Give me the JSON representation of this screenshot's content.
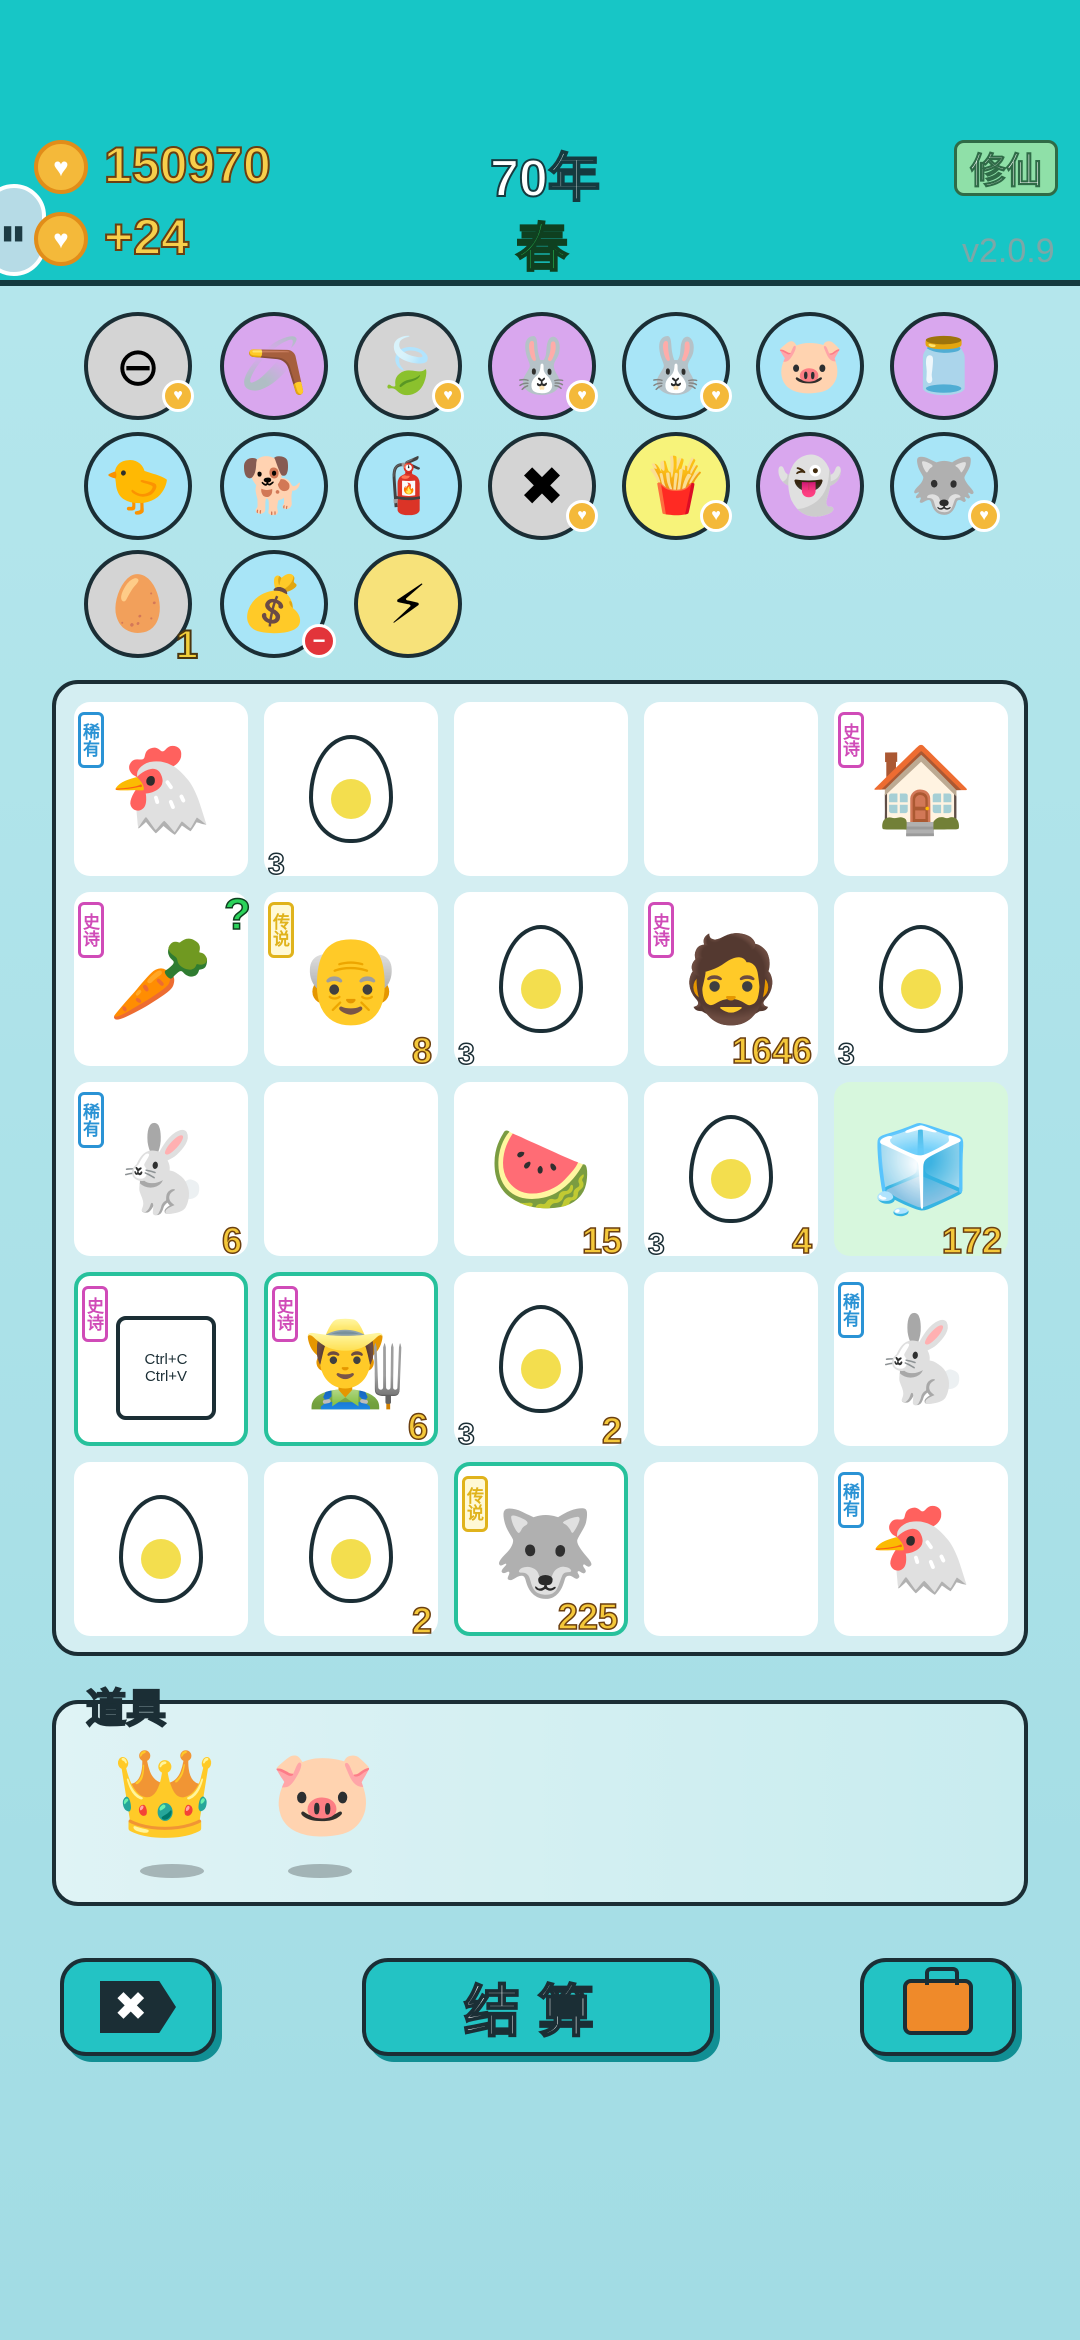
{
  "header": {
    "coins": "150970",
    "income": "+24",
    "year": "70年",
    "season": "春",
    "xiuxian_label": "修仙",
    "version": "v2.0.9"
  },
  "relics": [
    {
      "name": "remove-symbol-icon",
      "emoji": "⊖",
      "bg": "#d4d4d4",
      "badge": "heart"
    },
    {
      "name": "slingshot-icon",
      "emoji": "🪃",
      "bg": "#d9a7ee",
      "badge": ""
    },
    {
      "name": "leaf-icon",
      "emoji": "🍃",
      "bg": "#d4d4d4",
      "badge": "heart"
    },
    {
      "name": "twin-rabbits-icon",
      "emoji": "🐰",
      "bg": "#d9a7ee",
      "badge": "heart"
    },
    {
      "name": "twin-rabbits-icon",
      "emoji": "🐰",
      "bg": "#a8e5f7",
      "badge": "heart"
    },
    {
      "name": "piggy-bank-icon",
      "emoji": "🐷",
      "bg": "#a8e5f7",
      "badge": ""
    },
    {
      "name": "jar-icon",
      "emoji": "🫙",
      "bg": "#d9a7ee",
      "badge": ""
    },
    {
      "name": "chick-with-egg-icon",
      "emoji": "🐤",
      "bg": "#a8e5f7",
      "badge": ""
    },
    {
      "name": "cool-dog-icon",
      "emoji": "🐕",
      "bg": "#a8e5f7",
      "badge": ""
    },
    {
      "name": "pump-icon",
      "emoji": "🧯",
      "bg": "#a8e5f7",
      "badge": ""
    },
    {
      "name": "cancel-tag-icon",
      "emoji": "✖",
      "bg": "#d4d4d4",
      "badge": "heart"
    },
    {
      "name": "fries-icon",
      "emoji": "🍟",
      "bg": "#f7f37a",
      "badge": "heart"
    },
    {
      "name": "ghost-icon",
      "emoji": "👻",
      "bg": "#d9a7ee",
      "badge": ""
    },
    {
      "name": "husky-icon",
      "emoji": "🐺",
      "bg": "#a8e5f7",
      "badge": "heart"
    },
    {
      "name": "egg-tray-icon",
      "emoji": "🥚",
      "bg": "#d4d4d4",
      "badge": "",
      "count": "1"
    },
    {
      "name": "sack-icon",
      "emoji": "💰",
      "bg": "#a8e5f7",
      "badge": "minus"
    },
    {
      "name": "lightning-icon",
      "emoji": "⚡",
      "bg": "#f7e27a",
      "badge": ""
    }
  ],
  "tags": {
    "rare": "稀有",
    "epic": "史诗",
    "legend": "传说"
  },
  "board": [
    [
      {
        "icon": "chicken-icon",
        "emoji": "🐔",
        "tag": "rare",
        "left": "",
        "right": ""
      },
      {
        "icon": "egg-icon",
        "emoji": "egg",
        "tag": "",
        "left": "3",
        "right": ""
      },
      {
        "icon": "",
        "emoji": "",
        "tag": "",
        "left": "",
        "right": ""
      },
      {
        "icon": "",
        "emoji": "",
        "tag": "",
        "left": "",
        "right": ""
      },
      {
        "icon": "rabbit-house-icon",
        "emoji": "🏠",
        "tag": "epic",
        "left": "",
        "right": ""
      }
    ],
    [
      {
        "icon": "carrot-icon",
        "emoji": "🥕",
        "tag": "epic",
        "left": "",
        "right": "",
        "question": "?"
      },
      {
        "icon": "grandpa-icon",
        "emoji": "👴",
        "tag": "legend",
        "left": "",
        "right": "8"
      },
      {
        "icon": "egg-icon",
        "emoji": "egg",
        "tag": "",
        "left": "3",
        "right": ""
      },
      {
        "icon": "bearded-man-icon",
        "emoji": "🧔",
        "tag": "epic",
        "left": "",
        "right": "1646"
      },
      {
        "icon": "egg-icon",
        "emoji": "egg",
        "tag": "",
        "left": "3",
        "right": ""
      }
    ],
    [
      {
        "icon": "rabbit-icon",
        "emoji": "🐇",
        "tag": "rare",
        "left": "",
        "right": "6"
      },
      {
        "icon": "",
        "emoji": "",
        "tag": "",
        "left": "",
        "right": ""
      },
      {
        "icon": "watermelon-icon",
        "emoji": "🍉",
        "tag": "",
        "left": "",
        "right": "15"
      },
      {
        "icon": "egg-icon",
        "emoji": "egg",
        "tag": "",
        "left": "3",
        "right": "4"
      },
      {
        "icon": "fridge-icon",
        "emoji": "🧊",
        "tag": "",
        "left": "",
        "right": "172",
        "fridge": true
      }
    ],
    [
      {
        "icon": "copy-paste-card-icon",
        "emoji": "ctrl",
        "tag": "epic",
        "left": "",
        "right": "",
        "hl": true
      },
      {
        "icon": "farmer-icon",
        "emoji": "👨‍🌾",
        "tag": "epic",
        "left": "",
        "right": "6",
        "hl": true
      },
      {
        "icon": "egg-icon",
        "emoji": "egg",
        "tag": "",
        "left": "3",
        "right": "2"
      },
      {
        "icon": "",
        "emoji": "",
        "tag": "",
        "left": "",
        "right": ""
      },
      {
        "icon": "rabbit-icon",
        "emoji": "🐇",
        "tag": "rare",
        "left": "",
        "right": ""
      }
    ],
    [
      {
        "icon": "egg-icon",
        "emoji": "egg",
        "tag": "",
        "left": "",
        "right": ""
      },
      {
        "icon": "egg-icon",
        "emoji": "egg",
        "tag": "",
        "left": "",
        "right": "2"
      },
      {
        "icon": "husky-king-icon",
        "emoji": "🐺",
        "tag": "legend",
        "left": "",
        "right": "225",
        "hl": true
      },
      {
        "icon": "",
        "emoji": "",
        "tag": "",
        "left": "",
        "right": ""
      },
      {
        "icon": "chicken-icon",
        "emoji": "🐔",
        "tag": "rare",
        "left": "",
        "right": ""
      }
    ]
  ],
  "ctrl_card": {
    "line1": "Ctrl+C",
    "line2": "Ctrl+V"
  },
  "items": {
    "title": "道具",
    "list": [
      {
        "name": "crown-item-icon",
        "emoji": "👑"
      },
      {
        "name": "piggy-item-icon",
        "emoji": "🐷"
      }
    ]
  },
  "buttons": {
    "cancel_symbol": "✖",
    "settle_label": "结算"
  },
  "colors": {
    "topbar": "#17c6c6",
    "accent": "#23c3c4",
    "coin": "#f4b93a"
  }
}
